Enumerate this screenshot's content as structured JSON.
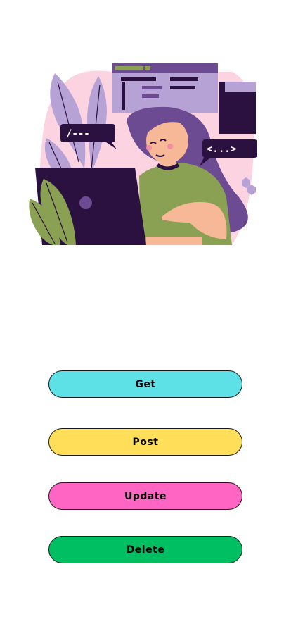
{
  "hero": {
    "code_bubble_left": "/---",
    "code_bubble_right": "<...>"
  },
  "buttons": [
    {
      "label": "Get",
      "color": "#5ee1e6"
    },
    {
      "label": "Post",
      "color": "#ffdf59"
    },
    {
      "label": "Update",
      "color": "#ff66c3"
    },
    {
      "label": "Delete",
      "color": "#00bf62"
    }
  ]
}
